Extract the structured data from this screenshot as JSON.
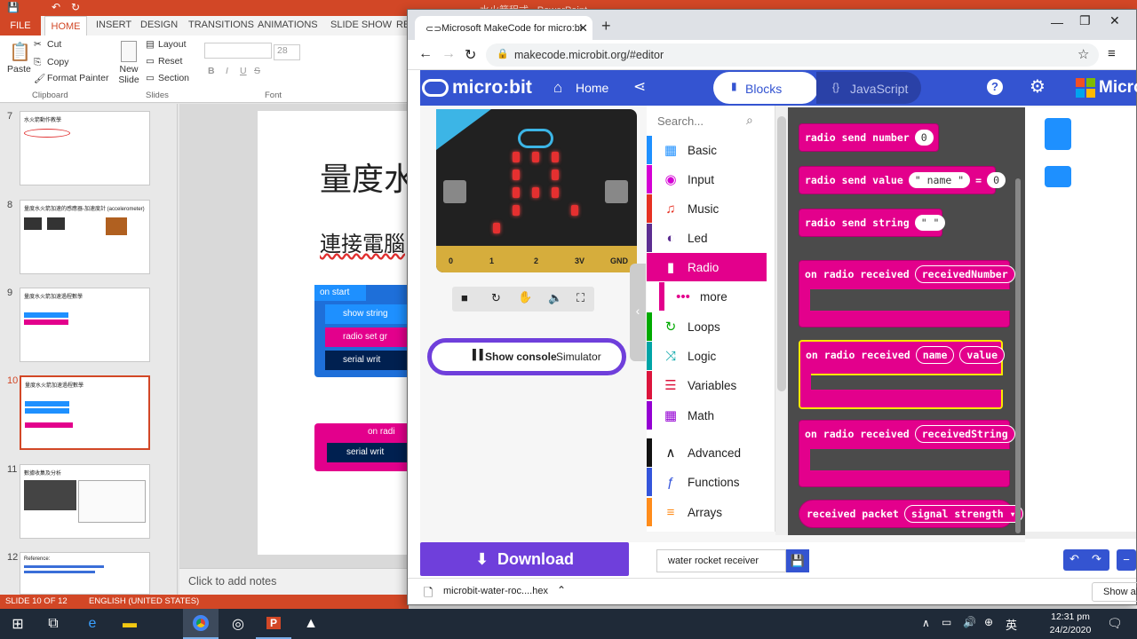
{
  "ppt": {
    "title": "水火箭程式 - PowerPoint",
    "tabs": [
      "FILE",
      "HOME",
      "INSERT",
      "DESIGN",
      "TRANSITIONS",
      "ANIMATIONS",
      "SLIDE SHOW",
      "RE"
    ],
    "clipboard": {
      "paste": "Paste",
      "cut": "Cut",
      "copy": "Copy",
      "format_painter": "Format Painter",
      "group": "Clipboard"
    },
    "slides_group": {
      "new_slide": "New Slide",
      "layout": "Layout",
      "reset": "Reset",
      "section": "Section",
      "group": "Slides"
    },
    "font_group": {
      "size": "28",
      "group": "Font"
    },
    "thumbnails": [
      {
        "num": "7",
        "title": "水火箭動作教學"
      },
      {
        "num": "8",
        "title": "量度水火箭加速的感應器-加速度計 (accelerometer)"
      },
      {
        "num": "9",
        "title": "量度水火箭加速過程數學"
      },
      {
        "num": "10",
        "title": "量度水火箭加速過程數學"
      },
      {
        "num": "11",
        "title": "數據收集及分析"
      },
      {
        "num": "12",
        "title": "Reference:"
      }
    ],
    "slide_title": "量度水",
    "slide_subtitle": "連接電腦",
    "code_on_start": "on start",
    "code_show_string": "show string",
    "code_radio_set": "radio set gr",
    "code_serial_write": "serial writ",
    "code_on_radio": "on radi",
    "code_serial_write2": "serial writ",
    "notes_placeholder": "Click to add notes",
    "status_slide": "SLIDE 10 OF 12",
    "status_lang": "ENGLISH (UNITED STATES)"
  },
  "browser": {
    "tab_title": "Microsoft MakeCode for micro:bi",
    "url": "makecode.microbit.org/#editor"
  },
  "makecode": {
    "logo": "micro:bit",
    "home": "Home",
    "blocks_tab": "Blocks",
    "js_tab": "JavaScript",
    "brand": "Micro",
    "pins": [
      "0",
      "1",
      "2",
      "3V",
      "GND"
    ],
    "show_console": "Show console",
    "simulator": "Simulator",
    "search_placeholder": "Search...",
    "toolbox": [
      {
        "label": "Basic",
        "color": "#1e90ff",
        "icon": "▦"
      },
      {
        "label": "Input",
        "color": "#d400d4",
        "icon": "◉"
      },
      {
        "label": "Music",
        "color": "#e63022",
        "icon": "♫"
      },
      {
        "label": "Led",
        "color": "#5c2d91",
        "icon": "◐"
      },
      {
        "label": "Radio",
        "color": "#e3008c",
        "icon": "▮"
      },
      {
        "label": "more",
        "color": "#e3008c",
        "icon": "•••"
      },
      {
        "label": "Loops",
        "color": "#00aa00",
        "icon": "↻"
      },
      {
        "label": "Logic",
        "color": "#00a4a6",
        "icon": "⤨"
      },
      {
        "label": "Variables",
        "color": "#dc143c",
        "icon": "☰"
      },
      {
        "label": "Math",
        "color": "#9400d3",
        "icon": "▦"
      },
      {
        "label": "Advanced",
        "color": "#111111",
        "icon": "∧"
      },
      {
        "label": "Functions",
        "color": "#3455db",
        "icon": "ƒ"
      },
      {
        "label": "Arrays",
        "color": "#ff8c1a",
        "icon": "≡"
      }
    ],
    "blocks": {
      "send_number": "radio send number",
      "send_number_val": "0",
      "send_value": "radio send value",
      "send_value_name": "\" name \"",
      "send_value_eq": "=",
      "send_value_val": "0",
      "send_string": "radio send string",
      "send_string_val": "\" \"",
      "on_received": "on radio received",
      "received_number": "receivedNumber",
      "name": "name",
      "value": "value",
      "received_string": "receivedString",
      "received_packet": "received packet",
      "signal_strength": "signal strength ▾"
    },
    "download": "Download",
    "project_name": "water rocket receiver",
    "download_file": "microbit-water-roc....hex",
    "show_all": "Show all"
  },
  "taskbar": {
    "ime": "英",
    "time": "12:31 pm",
    "date": "24/2/2020"
  }
}
